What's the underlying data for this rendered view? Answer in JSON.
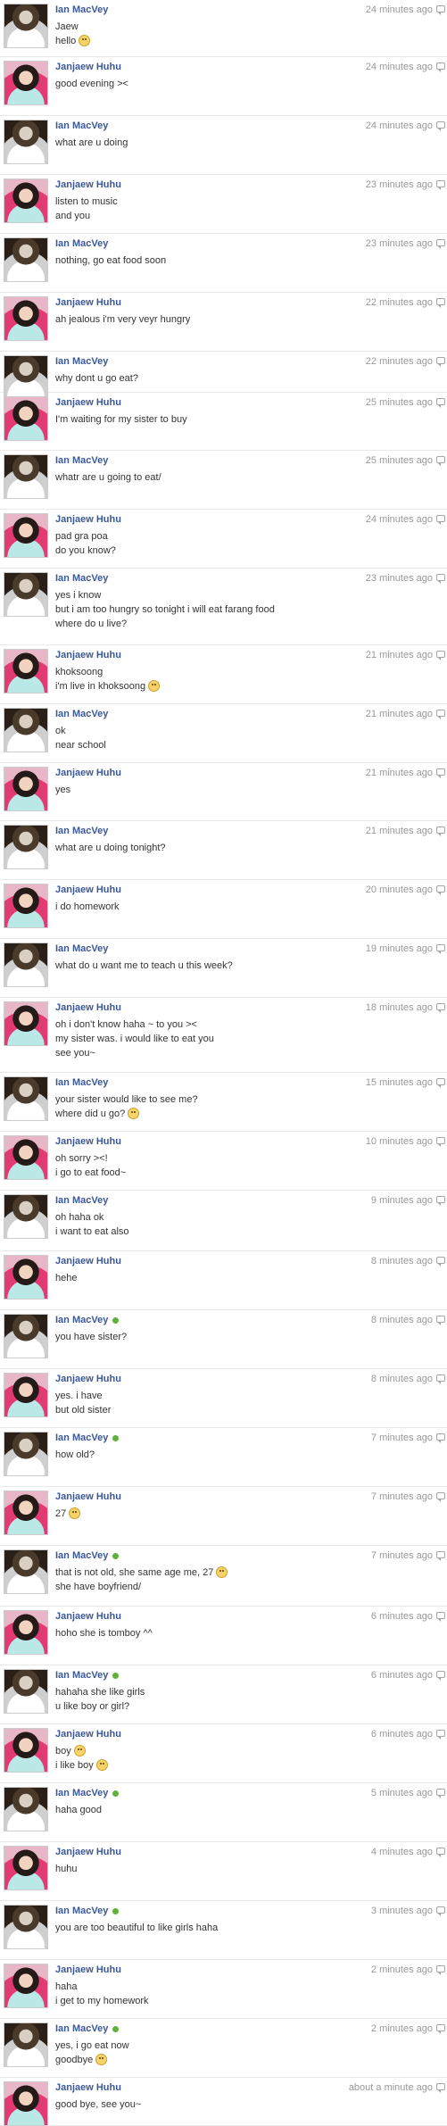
{
  "users": {
    "ian": "Ian MacVey",
    "jan": "Janjaew Huhu"
  },
  "messages": [
    {
      "who": "ian",
      "name": "Ian MacVey",
      "time": "24 minutes ago",
      "online": false,
      "lines": [
        "Jaew",
        "hello"
      ],
      "emoji": [
        null,
        "smile"
      ]
    },
    {
      "who": "jan",
      "name": "Janjaew Huhu",
      "time": "24 minutes ago",
      "online": false,
      "lines": [
        "good evening ><"
      ],
      "emoji": [
        null
      ]
    },
    {
      "who": "ian",
      "name": "Ian MacVey",
      "time": "24 minutes ago",
      "online": false,
      "lines": [
        "what are u doing"
      ],
      "emoji": [
        null
      ]
    },
    {
      "who": "jan",
      "name": "Janjaew Huhu",
      "time": "23 minutes ago",
      "online": false,
      "lines": [
        "listen to music",
        "and you"
      ],
      "emoji": [
        null,
        null
      ]
    },
    {
      "who": "ian",
      "name": "Ian MacVey",
      "time": "23 minutes ago",
      "online": false,
      "lines": [
        "nothing, go eat food soon"
      ],
      "emoji": [
        null
      ]
    },
    {
      "who": "jan",
      "name": "Janjaew Huhu",
      "time": "22 minutes ago",
      "online": false,
      "lines": [
        "ah jealous i'm very veyr hungry"
      ],
      "emoji": [
        null
      ]
    },
    {
      "who": "ian",
      "name": "Ian MacVey",
      "time": "22 minutes ago",
      "online": false,
      "lines": [
        "why dont u go eat?"
      ],
      "emoji": [
        null
      ]
    },
    {
      "who": "jan",
      "name": "Janjaew Huhu",
      "time": "25 minutes ago",
      "online": false,
      "lines": [
        "I'm waiting for my sister to buy"
      ],
      "emoji": [
        null
      ]
    },
    {
      "who": "ian",
      "name": "Ian MacVey",
      "time": "25 minutes ago",
      "online": false,
      "lines": [
        "whatr are u going to eat/"
      ],
      "emoji": [
        null
      ]
    },
    {
      "who": "jan",
      "name": "Janjaew Huhu",
      "time": "24 minutes ago",
      "online": false,
      "lines": [
        "pad gra poa",
        "do you know?"
      ],
      "emoji": [
        null,
        null
      ]
    },
    {
      "who": "ian",
      "name": "Ian MacVey",
      "time": "23 minutes ago",
      "online": false,
      "lines": [
        "yes i know",
        "but i am too hungry so tonight i will eat farang food",
        "where do u live?"
      ],
      "emoji": [
        null,
        null,
        null
      ]
    },
    {
      "who": "jan",
      "name": "Janjaew Huhu",
      "time": "21 minutes ago",
      "online": false,
      "lines": [
        "khoksoong",
        "i'm live in khoksoong"
      ],
      "emoji": [
        null,
        "smile"
      ]
    },
    {
      "who": "ian",
      "name": "Ian MacVey",
      "time": "21 minutes ago",
      "online": false,
      "lines": [
        "ok",
        "near school"
      ],
      "emoji": [
        null,
        null
      ]
    },
    {
      "who": "jan",
      "name": "Janjaew Huhu",
      "time": "21 minutes ago",
      "online": false,
      "lines": [
        "yes"
      ],
      "emoji": [
        null
      ]
    },
    {
      "who": "ian",
      "name": "Ian MacVey",
      "time": "21 minutes ago",
      "online": false,
      "lines": [
        "what are u doing tonight?"
      ],
      "emoji": [
        null
      ]
    },
    {
      "who": "jan",
      "name": "Janjaew Huhu",
      "time": "20 minutes ago",
      "online": false,
      "lines": [
        "i do homework"
      ],
      "emoji": [
        null
      ]
    },
    {
      "who": "ian",
      "name": "Ian MacVey",
      "time": "19 minutes ago",
      "online": false,
      "lines": [
        "what do u want me to teach u this week?"
      ],
      "emoji": [
        null
      ]
    },
    {
      "who": "jan",
      "name": "Janjaew Huhu",
      "time": "18 minutes ago",
      "online": false,
      "lines": [
        "oh i don't know haha ~ to you ><",
        "my sister was. i would like to eat you",
        "see you~"
      ],
      "emoji": [
        null,
        null,
        null
      ]
    },
    {
      "who": "ian",
      "name": "Ian MacVey",
      "time": "15 minutes ago",
      "online": false,
      "lines": [
        "your sister would like to see me?",
        "where did u go?"
      ],
      "emoji": [
        null,
        "smile"
      ]
    },
    {
      "who": "jan",
      "name": "Janjaew Huhu",
      "time": "10 minutes ago",
      "online": false,
      "lines": [
        "oh sorry ><!",
        "i go to eat food~"
      ],
      "emoji": [
        null,
        null
      ]
    },
    {
      "who": "ian",
      "name": "Ian MacVey",
      "time": "9 minutes ago",
      "online": false,
      "lines": [
        "oh haha ok",
        "i want to eat also"
      ],
      "emoji": [
        null,
        null
      ]
    },
    {
      "who": "jan",
      "name": "Janjaew Huhu",
      "time": "8 minutes ago",
      "online": false,
      "lines": [
        "hehe"
      ],
      "emoji": [
        null
      ]
    },
    {
      "who": "ian",
      "name": "Ian MacVey",
      "time": "8 minutes ago",
      "online": true,
      "lines": [
        "you have sister?"
      ],
      "emoji": [
        null
      ]
    },
    {
      "who": "jan",
      "name": "Janjaew Huhu",
      "time": "8 minutes ago",
      "online": false,
      "lines": [
        "yes. i have",
        "but old sister"
      ],
      "emoji": [
        null,
        null
      ]
    },
    {
      "who": "ian",
      "name": "Ian MacVey",
      "time": "7 minutes ago",
      "online": true,
      "lines": [
        "how old?"
      ],
      "emoji": [
        null
      ]
    },
    {
      "who": "jan",
      "name": "Janjaew Huhu",
      "time": "7 minutes ago",
      "online": false,
      "lines": [
        "27"
      ],
      "emoji": [
        "smile"
      ]
    },
    {
      "who": "ian",
      "name": "Ian MacVey",
      "time": "7 minutes ago",
      "online": true,
      "lines": [
        "that is not old, she same age me, 27",
        "she have boyfriend/"
      ],
      "emoji": [
        "smile",
        null
      ]
    },
    {
      "who": "jan",
      "name": "Janjaew Huhu",
      "time": "6 minutes ago",
      "online": false,
      "lines": [
        "hoho she is tomboy ^^"
      ],
      "emoji": [
        null
      ]
    },
    {
      "who": "ian",
      "name": "Ian MacVey",
      "time": "6 minutes ago",
      "online": true,
      "lines": [
        "hahaha she like girls",
        "u like boy or girl?"
      ],
      "emoji": [
        null,
        null
      ]
    },
    {
      "who": "jan",
      "name": "Janjaew Huhu",
      "time": "6 minutes ago",
      "online": false,
      "lines": [
        "boy",
        "i like boy"
      ],
      "emoji": [
        "tongue",
        "smile"
      ]
    },
    {
      "who": "ian",
      "name": "Ian MacVey",
      "time": "5 minutes ago",
      "online": true,
      "lines": [
        "haha good"
      ],
      "emoji": [
        null
      ]
    },
    {
      "who": "jan",
      "name": "Janjaew Huhu",
      "time": "4 minutes ago",
      "online": false,
      "lines": [
        "huhu"
      ],
      "emoji": [
        null
      ]
    },
    {
      "who": "ian",
      "name": "Ian MacVey",
      "time": "3 minutes ago",
      "online": true,
      "lines": [
        "you are too beautiful to like girls haha"
      ],
      "emoji": [
        null
      ]
    },
    {
      "who": "jan",
      "name": "Janjaew Huhu",
      "time": "2 minutes ago",
      "online": false,
      "lines": [
        "haha",
        "i get to my homework"
      ],
      "emoji": [
        null,
        null
      ]
    },
    {
      "who": "ian",
      "name": "Ian MacVey",
      "time": "2 minutes ago",
      "online": true,
      "lines": [
        "yes, i go eat now",
        "goodbye"
      ],
      "emoji": [
        null,
        "smile"
      ]
    },
    {
      "who": "jan",
      "name": "Janjaew Huhu",
      "time": "about a minute ago",
      "online": false,
      "lines": [
        "good bye, see you~"
      ],
      "emoji": [
        null
      ]
    }
  ]
}
